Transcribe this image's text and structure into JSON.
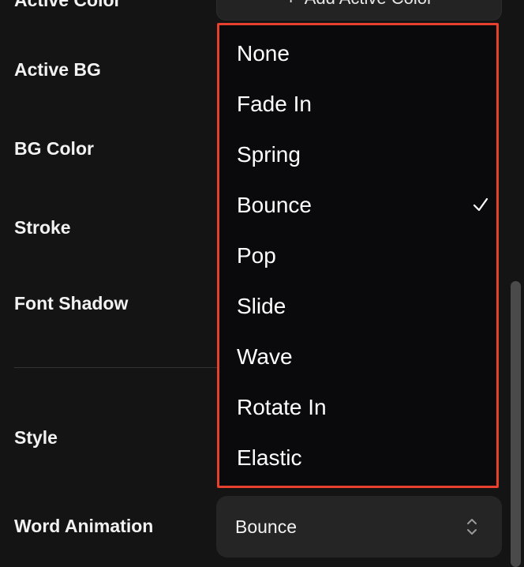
{
  "top_button": {
    "icon": "plus-icon",
    "label": "Add Active Color"
  },
  "labels": {
    "active_color": "Active Color",
    "active_bg": "Active BG",
    "bg_color": "BG Color",
    "stroke": "Stroke",
    "font_shadow": "Font Shadow",
    "style": "Style",
    "word_animation": "Word Animation"
  },
  "dropdown": {
    "selected": "Bounce",
    "options": [
      "None",
      "Fade In",
      "Spring",
      "Bounce",
      "Pop",
      "Slide",
      "Wave",
      "Rotate In",
      "Elastic"
    ],
    "check_icon": "checkmark-icon",
    "highlight_border_color": "#e8402f"
  },
  "select": {
    "value": "Bounce",
    "icon": "chevron-updown-icon"
  },
  "colors": {
    "background": "#141414",
    "dropdown_bg": "#0a0a0c",
    "control_bg": "#252525"
  }
}
